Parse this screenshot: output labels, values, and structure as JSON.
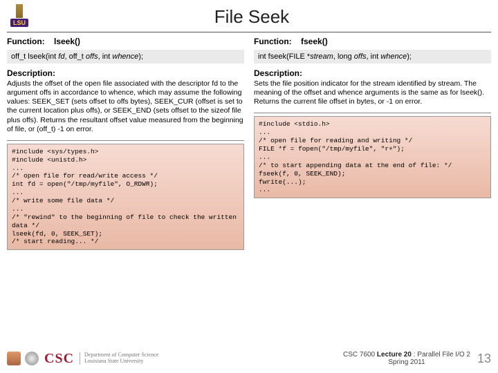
{
  "logo_text": "LSU",
  "title": "File Seek",
  "left": {
    "func_label": "Function:",
    "func_name": "lseek()",
    "signature_pre": "off_t lseek(int ",
    "signature_i1": "fd",
    "signature_mid1": ", off_t ",
    "signature_i2": "offs",
    "signature_mid2": ", int ",
    "signature_i3": "whence",
    "signature_post": ");",
    "desc_label": "Description:",
    "desc": "Adjusts the offset of the open file associated with the descriptor fd to the argument offs in accordance to whence, which may assume the following values: SEEK_SET (sets offset to offs bytes), SEEK_CUR (offset is set to the current location plus offs), or SEEK_END (sets offset to the sizeof file plus offs). Returns the resultant offset value measured from the beginning of file, or (off_t) -1 on error.",
    "code": "#include <sys/types.h>\n#include <unistd.h>\n...\n/* open file for read/write access */\nint fd = open(\"/tmp/myfile\", O_RDWR);\n...\n/* write some file data */\n...\n/* \"rewind\" to the beginning of file to check the written data */\nlseek(fd, 0, SEEK_SET);\n/* start reading... */"
  },
  "right": {
    "func_label": "Function:",
    "func_name": "fseek()",
    "signature_pre": "int fseek(FILE *",
    "signature_i1": "stream",
    "signature_mid1": ", long ",
    "signature_i2": "offs",
    "signature_mid2": ", int ",
    "signature_i3": "whence",
    "signature_post": ");",
    "desc_label": "Description:",
    "desc": "Sets the file position indicator for the stream identified by stream. The meaning of the offset and whence arguments is the same as for lseek(). Returns the current file offset in bytes, or -1 on error.",
    "code": "#include <stdio.h>\n...\n/* open file for reading and writing */\nFILE *f = fopen(\"/tmp/myfile\", \"r+\");\n...\n/* to start appending data at the end of file: */\nfseek(f, 0, SEEK_END);\nfwrite(...);\n..."
  },
  "footer": {
    "csc": "CSC",
    "dept1": "Department of Computer Science",
    "dept2": "Louisiana State University",
    "lecture_pre": "CSC 7600 ",
    "lecture_bold": "Lecture 20",
    "lecture_post": " : Parallel File I/O 2",
    "term": "Spring 2011",
    "page": "13"
  }
}
